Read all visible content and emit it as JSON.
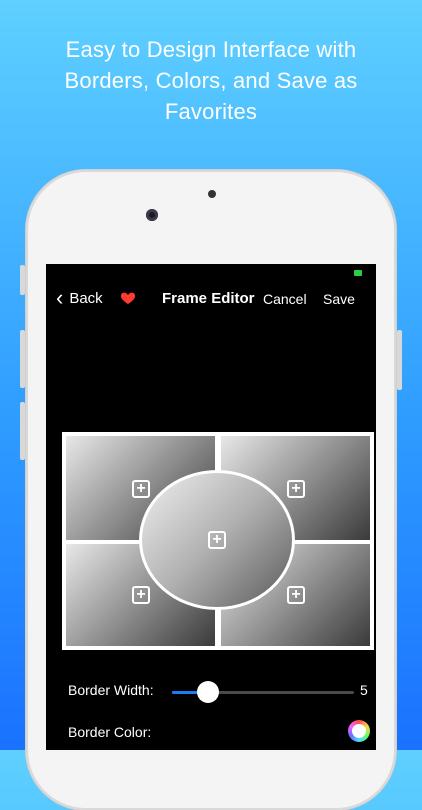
{
  "caption": {
    "line1": "Easy to Design Interface with",
    "line2": "Borders, Colors, and Save as",
    "line3": "Favorites"
  },
  "nav": {
    "back_label": "Back",
    "title": "Frame Editor",
    "cancel_label": "Cancel",
    "save_label": "Save"
  },
  "frame": {
    "cells": [
      {
        "name": "top-left",
        "icon": "plus-icon"
      },
      {
        "name": "top-right",
        "icon": "plus-icon"
      },
      {
        "name": "center-ellipse",
        "icon": "plus-icon"
      },
      {
        "name": "bottom-left",
        "icon": "plus-icon"
      },
      {
        "name": "bottom-right",
        "icon": "plus-icon"
      }
    ]
  },
  "controls": {
    "border_width_label": "Border Width:",
    "border_width_value": "5",
    "border_width_fraction": 0.2,
    "border_color_label": "Border Color:"
  },
  "colors": {
    "accent": "#1e7cf2",
    "heart": "#ff3b30",
    "status": "#2ecc40"
  }
}
